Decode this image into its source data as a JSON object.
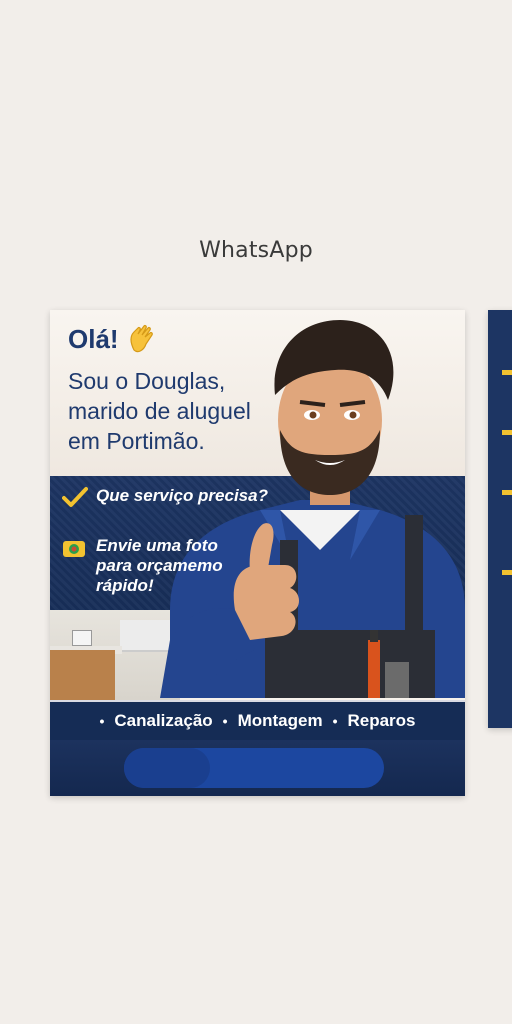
{
  "header": {
    "app_title": "WhatsApp"
  },
  "card": {
    "greeting": "Olá!",
    "intro_lines": [
      "Sou o Douglas,",
      "marido de aluguel",
      "em Portimão."
    ],
    "question": "Que serviço precisa?",
    "photo_cta_lines": [
      "Envie uma foto",
      "para orçamemo",
      "rápido!"
    ],
    "services": [
      "Canalização",
      "Montagem",
      "Reparos"
    ]
  },
  "colors": {
    "page_bg": "#f2eeea",
    "navy": "#1d3563",
    "text_blue": "#1f3a6e",
    "accent_yellow": "#f2c230"
  },
  "icons": {
    "wave": "waving-hand-icon",
    "check": "check-icon",
    "camera": "camera-icon"
  }
}
